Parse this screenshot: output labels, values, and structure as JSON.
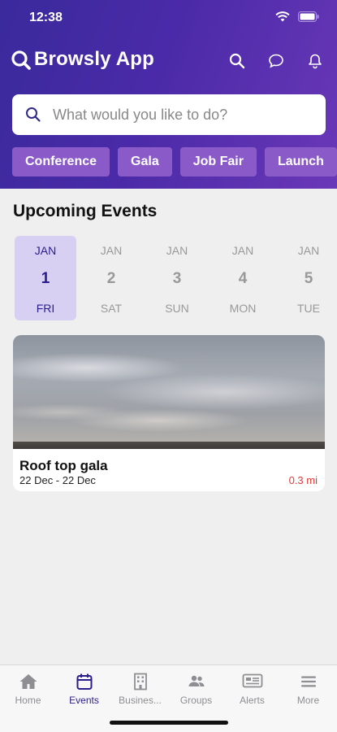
{
  "status_bar": {
    "time": "12:38"
  },
  "app": {
    "title": "Browsly App"
  },
  "search": {
    "placeholder": "What would you like to do?"
  },
  "chips": [
    "Conference",
    "Gala",
    "Job Fair",
    "Launch"
  ],
  "section": {
    "title": "Upcoming Events"
  },
  "dates": [
    {
      "month": "JAN",
      "day": "1",
      "weekday": "FRI",
      "selected": true
    },
    {
      "month": "JAN",
      "day": "2",
      "weekday": "SAT",
      "selected": false
    },
    {
      "month": "JAN",
      "day": "3",
      "weekday": "SUN",
      "selected": false
    },
    {
      "month": "JAN",
      "day": "4",
      "weekday": "MON",
      "selected": false
    },
    {
      "month": "JAN",
      "day": "5",
      "weekday": "TUE",
      "selected": false
    }
  ],
  "event": {
    "title": "Roof top gala",
    "dates": "22 Dec - 22 Dec",
    "distance": "0.3 mi"
  },
  "tabs": [
    {
      "label": "Home",
      "icon": "home-icon",
      "active": false
    },
    {
      "label": "Events",
      "icon": "calendar-icon",
      "active": true
    },
    {
      "label": "Busines...",
      "icon": "building-icon",
      "active": false
    },
    {
      "label": "Groups",
      "icon": "people-icon",
      "active": false
    },
    {
      "label": "Alerts",
      "icon": "alerts-icon",
      "active": false
    },
    {
      "label": "More",
      "icon": "menu-icon",
      "active": false
    }
  ],
  "colors": {
    "header_start": "#3a2a9c",
    "header_end": "#6a38b8",
    "chip": "#8a5ac8",
    "selected_date_bg": "#d7d0f3",
    "active_tab": "#2a1d8c",
    "distance": "#e53935"
  }
}
